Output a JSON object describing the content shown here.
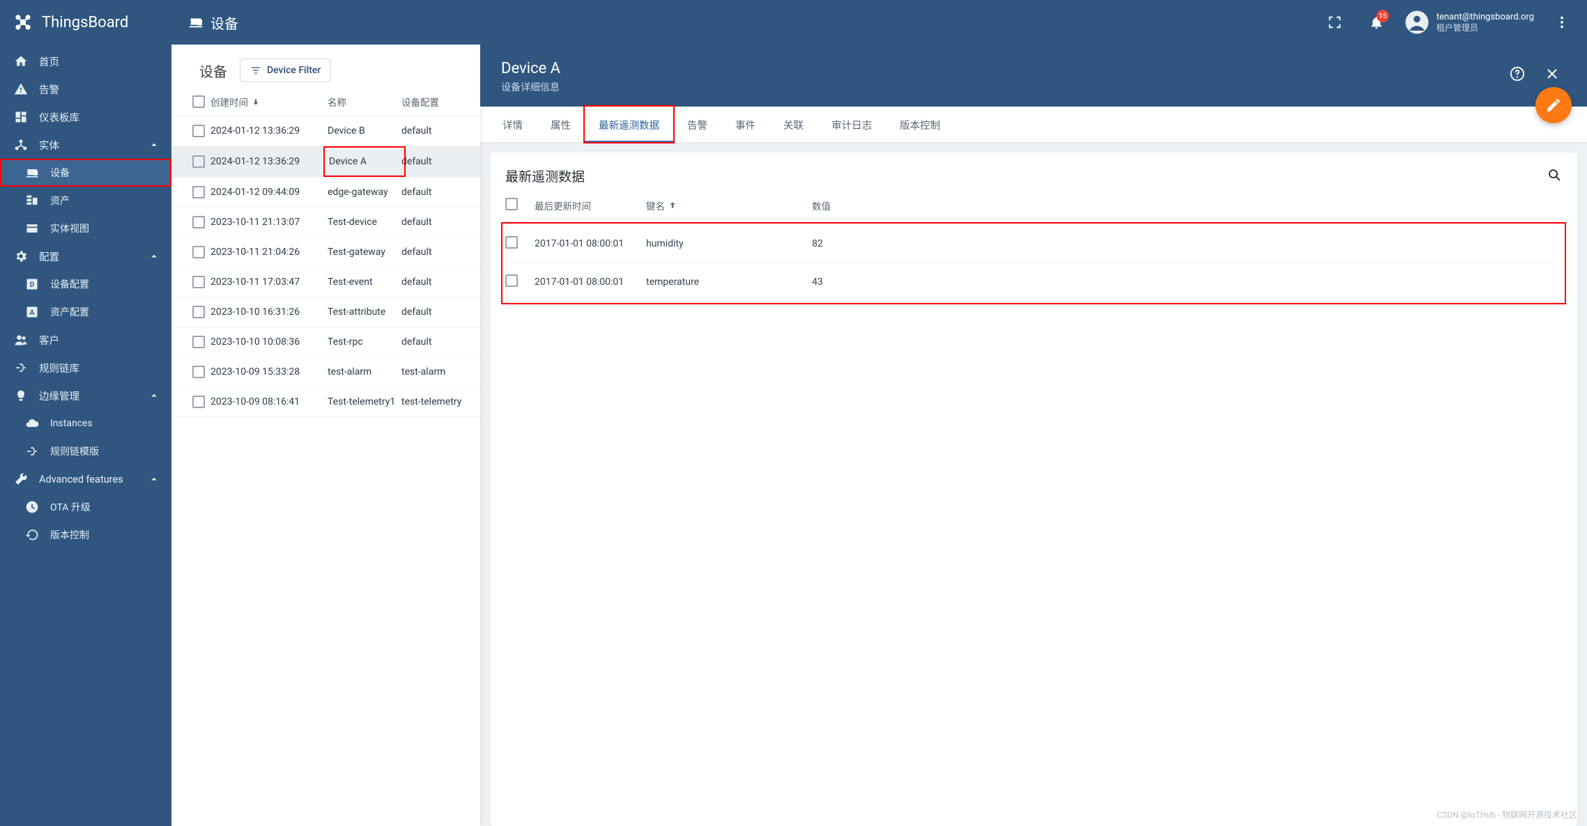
{
  "brand": "ThingsBoard",
  "page_icon": "devices",
  "page_title": "设备",
  "notifications_count": "15",
  "account": {
    "email": "tenant@thingsboard.org",
    "role": "租户管理员"
  },
  "sidebar": {
    "items": [
      {
        "icon": "home",
        "label": "首页",
        "type": "item"
      },
      {
        "icon": "warning",
        "label": "告警",
        "type": "item"
      },
      {
        "icon": "dashboard",
        "label": "仪表板库",
        "type": "item"
      },
      {
        "icon": "entities",
        "label": "实体",
        "type": "parent",
        "expanded": true
      },
      {
        "icon": "devices",
        "label": "设备",
        "type": "child",
        "selected": true,
        "redbox": true
      },
      {
        "icon": "domain",
        "label": "资产",
        "type": "child"
      },
      {
        "icon": "view",
        "label": "实体视图",
        "type": "child"
      },
      {
        "icon": "settings",
        "label": "配置",
        "type": "parent",
        "expanded": true
      },
      {
        "icon": "square-d",
        "label": "设备配置",
        "type": "child"
      },
      {
        "icon": "square-a",
        "label": "资产配置",
        "type": "child"
      },
      {
        "icon": "people",
        "label": "客户",
        "type": "item"
      },
      {
        "icon": "rulechain",
        "label": "规则链库",
        "type": "item"
      },
      {
        "icon": "edge",
        "label": "边缘管理",
        "type": "parent",
        "expanded": true
      },
      {
        "icon": "cloud",
        "label": "Instances",
        "type": "child"
      },
      {
        "icon": "rulechain",
        "label": "规则链模版",
        "type": "child"
      },
      {
        "icon": "wrench",
        "label": "Advanced features",
        "type": "parent",
        "expanded": true
      },
      {
        "icon": "ota",
        "label": "OTA 升级",
        "type": "child"
      },
      {
        "icon": "history",
        "label": "版本控制",
        "type": "child"
      }
    ]
  },
  "device_list": {
    "title": "设备",
    "filter_label": "Device Filter",
    "columns": {
      "created_time": "创建时间",
      "name": "名称",
      "profile": "设备配置"
    },
    "rows": [
      {
        "time": "2024-01-12 13:36:29",
        "name": "Device B",
        "profile": "default"
      },
      {
        "time": "2024-01-12 13:36:29",
        "name": "Device A",
        "profile": "default",
        "selected": true,
        "redbox": true
      },
      {
        "time": "2024-01-12 09:44:09",
        "name": "edge-gateway",
        "profile": "default"
      },
      {
        "time": "2023-10-11 21:13:07",
        "name": "Test-device",
        "profile": "default"
      },
      {
        "time": "2023-10-11 21:04:26",
        "name": "Test-gateway",
        "profile": "default"
      },
      {
        "time": "2023-10-11 17:03:47",
        "name": "Test-event",
        "profile": "default"
      },
      {
        "time": "2023-10-10 16:31:26",
        "name": "Test-attribute",
        "profile": "default"
      },
      {
        "time": "2023-10-10 10:08:36",
        "name": "Test-rpc",
        "profile": "default"
      },
      {
        "time": "2023-10-09 15:33:28",
        "name": "test-alarm",
        "profile": "test-alarm"
      },
      {
        "time": "2023-10-09 08:16:41",
        "name": "Test-telemetry1",
        "profile": "test-telemetry"
      }
    ]
  },
  "detail": {
    "title": "Device A",
    "subtitle": "设备详细信息",
    "tabs": [
      {
        "label": "详情"
      },
      {
        "label": "属性"
      },
      {
        "label": "最新遥测数据",
        "active": true,
        "redbox": true
      },
      {
        "label": "告警"
      },
      {
        "label": "事件"
      },
      {
        "label": "关联"
      },
      {
        "label": "审计日志"
      },
      {
        "label": "版本控制"
      }
    ],
    "telemetry": {
      "section_title": "最新遥测数据",
      "columns": {
        "time": "最后更新时间",
        "key": "键名",
        "value": "数值"
      },
      "rows": [
        {
          "time": "2017-01-01 08:00:01",
          "key": "humidity",
          "value": "82"
        },
        {
          "time": "2017-01-01 08:00:01",
          "key": "temperature",
          "value": "43"
        }
      ]
    }
  },
  "watermark": "CSDN @IoTHub - 物联网开源技术社区"
}
